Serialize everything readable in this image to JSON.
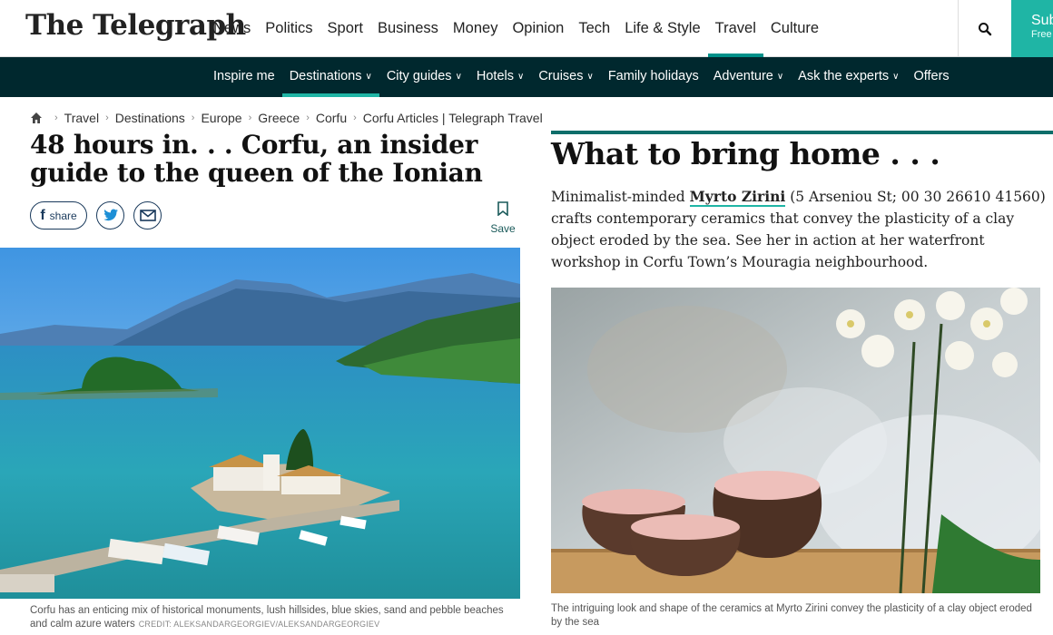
{
  "header": {
    "logo": "The Telegraph",
    "nav": [
      "News",
      "Politics",
      "Sport",
      "Business",
      "Money",
      "Opinion",
      "Tech",
      "Life & Style",
      "Travel",
      "Culture"
    ],
    "active_nav": "Travel",
    "subscribe_label": "Subscribe",
    "subscribe_sub": "Free for one month"
  },
  "subnav": {
    "items": [
      {
        "label": "Inspire me",
        "dropdown": false
      },
      {
        "label": "Destinations",
        "dropdown": true
      },
      {
        "label": "City guides",
        "dropdown": true
      },
      {
        "label": "Hotels",
        "dropdown": true
      },
      {
        "label": "Cruises",
        "dropdown": true
      },
      {
        "label": "Family holidays",
        "dropdown": false
      },
      {
        "label": "Adventure",
        "dropdown": true
      },
      {
        "label": "Ask the experts",
        "dropdown": true
      },
      {
        "label": "Offers",
        "dropdown": false
      }
    ],
    "active": "Destinations"
  },
  "breadcrumb": [
    "Travel",
    "Destinations",
    "Europe",
    "Greece",
    "Corfu",
    "Corfu Articles | Telegraph Travel"
  ],
  "article": {
    "headline": "48 hours in. . . Corfu, an insider guide to the queen of the Ionian",
    "share_label": "share",
    "save_label": "Save",
    "hero_caption": "Corfu has an enticing mix of historical monuments, lush hillsides, blue skies, sand and pebble beaches and calm azure waters",
    "hero_credit": "CREDIT: ALEKSANDARGEORGIEV/ALEKSANDARGEORGIEV"
  },
  "section": {
    "title": "What to bring home . . .",
    "body_pre": "Minimalist-minded ",
    "body_link": "Myrto Zirini",
    "body_post": " (5 Arseniou St; 00 30 26610 41560) crafts contemporary ceramics that convey the plasticity of a clay object eroded by the sea. See her in action at her waterfront workshop in Corfu Town’s Mouragia neighbourhood.",
    "image_caption": "The intriguing look and shape of the ceramics at Myrto Zirini convey the plasticity of a clay object eroded by the sea"
  },
  "colors": {
    "accent": "#1fb5a5",
    "subnav_bg": "#00282e",
    "rule": "#0d6e6a"
  }
}
